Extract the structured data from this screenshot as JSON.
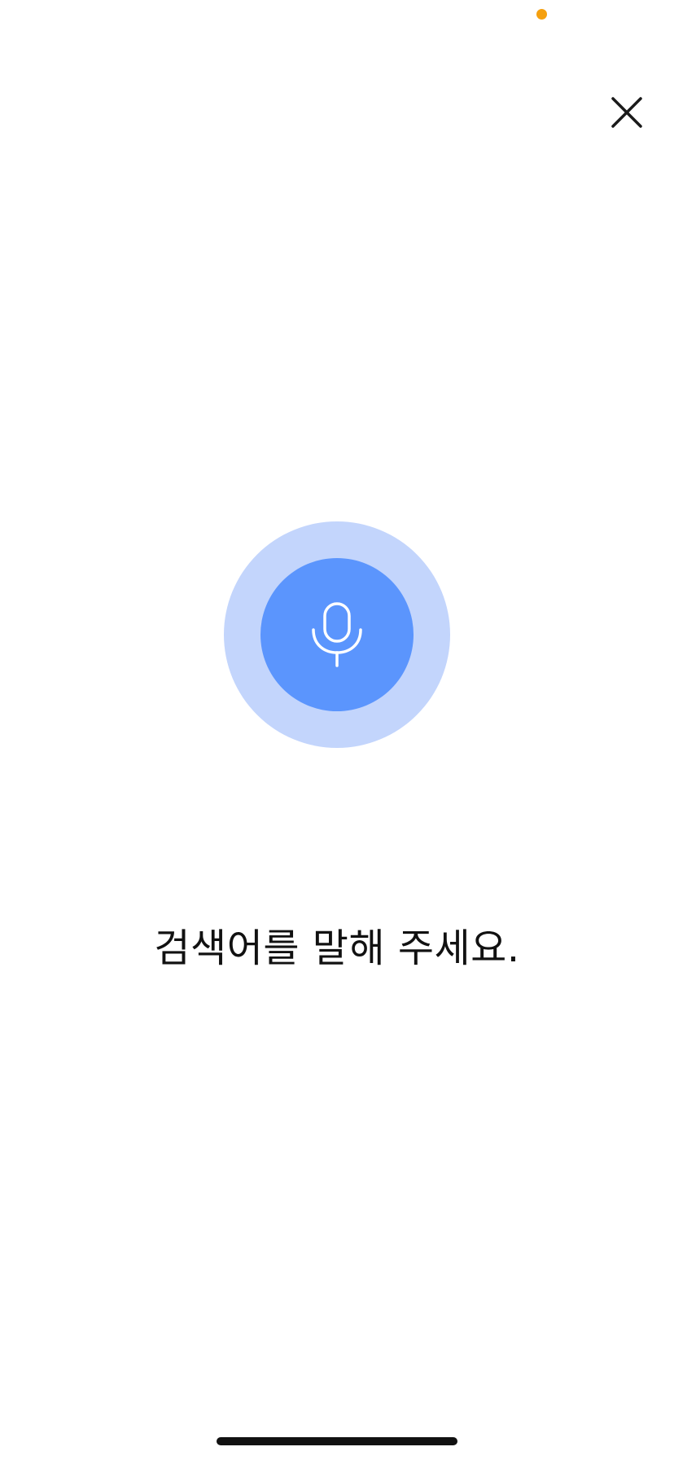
{
  "status": {
    "privacy_indicator_color": "#F5A00F"
  },
  "header": {
    "close_icon": "close-icon"
  },
  "voice": {
    "mic_icon": "microphone-icon",
    "halo_color": "#C3D5FC",
    "button_color": "#5B95FD",
    "icon_color": "#FFFFFF"
  },
  "prompt": {
    "text": "검색어를 말해 주세요."
  },
  "system": {
    "home_indicator_color": "#111111"
  }
}
